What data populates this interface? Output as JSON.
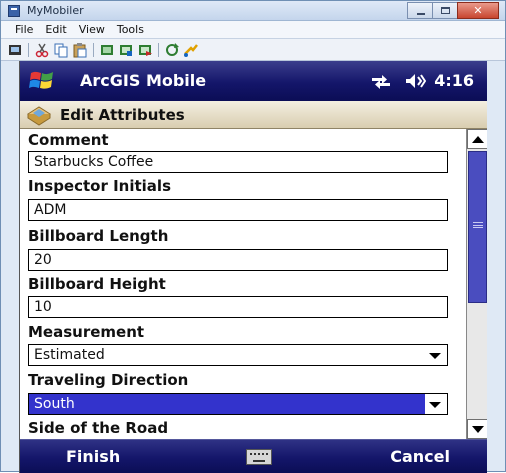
{
  "host_window": {
    "title": "MyMobiler",
    "controls": {
      "minimize": "–",
      "maximize": "□",
      "close": "✕"
    },
    "menu": [
      "File",
      "Edit",
      "View",
      "Tools"
    ]
  },
  "device": {
    "status_bar": {
      "title": "ArcGIS Mobile",
      "connectivity_icon": "connectivity-icon",
      "volume_icon": "volume-icon",
      "time": "4:16"
    },
    "header": {
      "icon": "form-edit-icon",
      "title": "Edit Attributes"
    },
    "fields": [
      {
        "label": "Comment",
        "value": "Starbucks Coffee",
        "type": "text"
      },
      {
        "label": "Inspector Initials",
        "value": "ADM",
        "type": "text"
      },
      {
        "label": "Billboard Length",
        "value": "20",
        "type": "text"
      },
      {
        "label": "Billboard Height",
        "value": "10",
        "type": "text"
      },
      {
        "label": "Measurement",
        "value": "Estimated",
        "type": "select"
      },
      {
        "label": "Traveling Direction",
        "value": "South",
        "type": "select",
        "selected": true
      },
      {
        "label": "Side of the Road",
        "value": "",
        "type": "select"
      }
    ],
    "softkeys": {
      "left": "Finish",
      "right": "Cancel",
      "keyboard_icon": "keyboard-icon"
    }
  },
  "colors": {
    "status_bar": "#14166a",
    "selection": "#3333cc",
    "scroll_thumb": "#4a4dbf",
    "header_bar": "#d9cdb0"
  }
}
